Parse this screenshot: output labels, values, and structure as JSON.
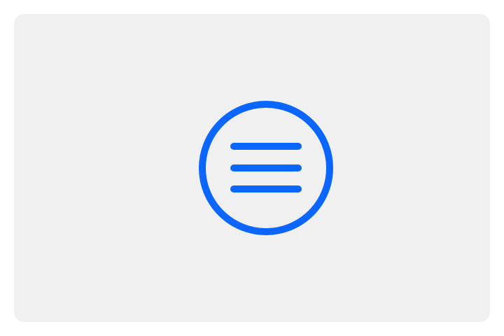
{
  "app": {
    "background_color": "#ffffff",
    "card_color": "#f0f0f0"
  },
  "menu_button": {
    "icon": "hamburger-menu-circle-icon",
    "accent_color": "#0a66ff"
  }
}
